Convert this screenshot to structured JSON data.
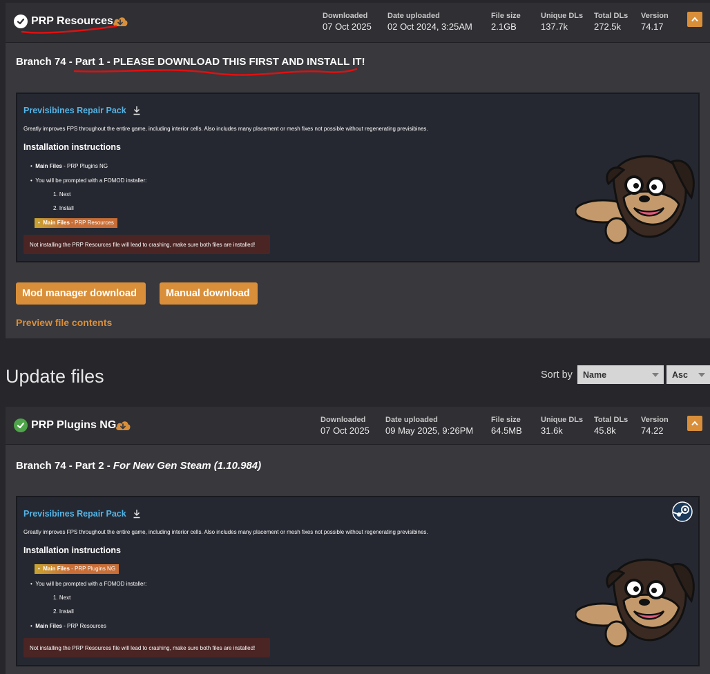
{
  "main_file": {
    "title": "PRP Resources",
    "stats": [
      {
        "label": "Downloaded",
        "value": "07 Oct 2025"
      },
      {
        "label": "Date uploaded",
        "value": "02 Oct 2024, 3:25AM"
      },
      {
        "label": "File size",
        "value": "2.1GB"
      },
      {
        "label": "Unique DLs",
        "value": "137.7k"
      },
      {
        "label": "Total DLs",
        "value": "272.5k"
      },
      {
        "label": "Version",
        "value": "74.17"
      }
    ],
    "branch": "Branch 74 - Part 1 - PLEASE DOWNLOAD THIS FIRST AND INSTALL IT!",
    "pack_title": "Previsibines Repair Pack",
    "pack_desc": "Greatly improves FPS throughout the entire game, including interior cells. Also includes many placement or mesh fixes not possible without regenerating previsibines.",
    "install_heading": "Installation instructions",
    "steps": {
      "main_label": "Main Files",
      "plugins_item": " - PRP Plugins NG",
      "fomod": "You will be prompted with a FOMOD installer:",
      "next": "1. Next",
      "install": "2. Install",
      "resources_item": " - PRP Resources"
    },
    "warning": "Not installing the PRP Resources file will lead to crashing, make sure both files are installed!",
    "mod_manager_button": "Mod manager download",
    "manual_button": "Manual download",
    "preview_link": "Preview file contents"
  },
  "update_section": {
    "title": "Update files",
    "sort_label": "Sort by",
    "sort_field": "Name",
    "sort_order": "Asc"
  },
  "update_file": {
    "title": "PRP Plugins NG",
    "stats": [
      {
        "label": "Downloaded",
        "value": "07 Oct 2025"
      },
      {
        "label": "Date uploaded",
        "value": "09 May 2025, 9:26PM"
      },
      {
        "label": "File size",
        "value": "64.5MB"
      },
      {
        "label": "Unique DLs",
        "value": "31.6k"
      },
      {
        "label": "Total DLs",
        "value": "45.8k"
      },
      {
        "label": "Version",
        "value": "74.22"
      }
    ],
    "branch_prefix": "Branch 74 - Part 2 - ",
    "branch_italic": "For New Gen Steam (1.10.984)",
    "pack_title": "Previsibines Repair Pack",
    "pack_desc": "Greatly improves FPS throughout the entire game, including interior cells. Also includes many placement or mesh fixes not possible without regenerating previsibines.",
    "install_heading": "Installation instructions",
    "steps": {
      "main_label": "Main Files",
      "plugins_item": " - PRP Plugins NG",
      "fomod": "You will be prompted with a FOMOD installer:",
      "next": "1. Next",
      "install": "2. Install",
      "resources_item": " - PRP Resources"
    },
    "warning": "Not installing the PRP Resources file will lead to crashing, make sure both files are installed!"
  },
  "colors": {
    "accent": "#d98f3a",
    "link_blue": "#53b4e6",
    "highlight": "#c86e36",
    "warning_bg": "#4a2524",
    "success_green": "#4fa34a",
    "annotation_red": "#e01010"
  },
  "icons": [
    "check-circle-icon",
    "cloud-download-icon",
    "download-arrow-icon",
    "chevron-up-icon",
    "steam-icon",
    "mascot-dog-illustration"
  ]
}
